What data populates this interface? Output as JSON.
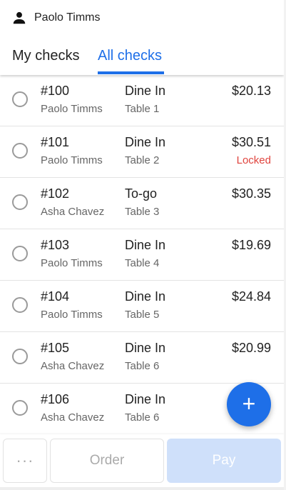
{
  "header": {
    "user_name": "Paolo Timms",
    "tabs": [
      {
        "label": "My checks",
        "active": false
      },
      {
        "label": "All checks",
        "active": true
      }
    ]
  },
  "checks": [
    {
      "number": "#100",
      "owner": "Paolo Timms",
      "type": "Dine In",
      "table": "Table 1",
      "amount": "$20.13",
      "status": ""
    },
    {
      "number": "#101",
      "owner": "Paolo Timms",
      "type": "Dine In",
      "table": "Table 2",
      "amount": "$30.51",
      "status": "Locked"
    },
    {
      "number": "#102",
      "owner": "Asha Chavez",
      "type": "To-go",
      "table": "Table 3",
      "amount": "$30.35",
      "status": ""
    },
    {
      "number": "#103",
      "owner": "Paolo Timms",
      "type": "Dine In",
      "table": "Table 4",
      "amount": "$19.69",
      "status": ""
    },
    {
      "number": "#104",
      "owner": "Paolo Timms",
      "type": "Dine In",
      "table": "Table 5",
      "amount": "$24.84",
      "status": ""
    },
    {
      "number": "#105",
      "owner": "Asha Chavez",
      "type": "Dine In",
      "table": "Table 6",
      "amount": "$20.99",
      "status": ""
    },
    {
      "number": "#106",
      "owner": "Asha Chavez",
      "type": "Dine In",
      "table": "Table 6",
      "amount": "",
      "status": ""
    }
  ],
  "fab": {
    "icon": "plus-icon",
    "glyph": "+"
  },
  "footer": {
    "more_label": "···",
    "order_label": "Order",
    "pay_label": "Pay"
  },
  "colors": {
    "accent": "#1e6fe8",
    "locked": "#e0443e",
    "pay_disabled": "#cfe0fa"
  }
}
